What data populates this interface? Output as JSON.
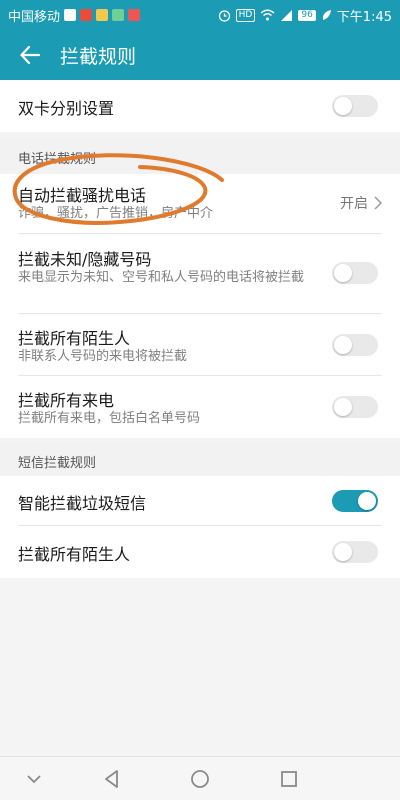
{
  "status_bar": {
    "carrier": "中国移动",
    "battery": "96",
    "time": "下午1:45",
    "icons": [
      "app-icon",
      "hd-icon",
      "wifi-icon",
      "signal-icon",
      "alarm-icon",
      "leaf-icon",
      "battery-icon"
    ]
  },
  "header": {
    "title": "拦截规则",
    "back_icon": "arrow-left-icon"
  },
  "dual_sim": {
    "label": "双卡分别设置",
    "enabled": false
  },
  "call_section": {
    "title": "电话拦截规则",
    "items": [
      {
        "title": "自动拦截骚扰电话",
        "subtitle": "诈骗，骚扰，广告推销，房产中介",
        "value": "开启"
      },
      {
        "title": "拦截未知/隐藏号码",
        "subtitle": "来电显示为未知、空号和私人号码的电话将被拦截",
        "enabled": false
      },
      {
        "title": "拦截所有陌生人",
        "subtitle": "非联系人号码的来电将被拦截",
        "enabled": false
      },
      {
        "title": "拦截所有来电",
        "subtitle": "拦截所有来电，包括白名单号码",
        "enabled": false
      }
    ]
  },
  "sms_section": {
    "title": "短信拦截规则",
    "items": [
      {
        "title": "智能拦截垃圾短信",
        "enabled": true
      },
      {
        "title": "拦截所有陌生人",
        "enabled": false
      }
    ]
  },
  "nav_bar": {
    "buttons": [
      "collapse-icon",
      "back-triangle-icon",
      "home-circle-icon",
      "recents-square-icon"
    ]
  },
  "colors": {
    "accent": "#1c9bb4",
    "annotation": "#e07a2c"
  }
}
